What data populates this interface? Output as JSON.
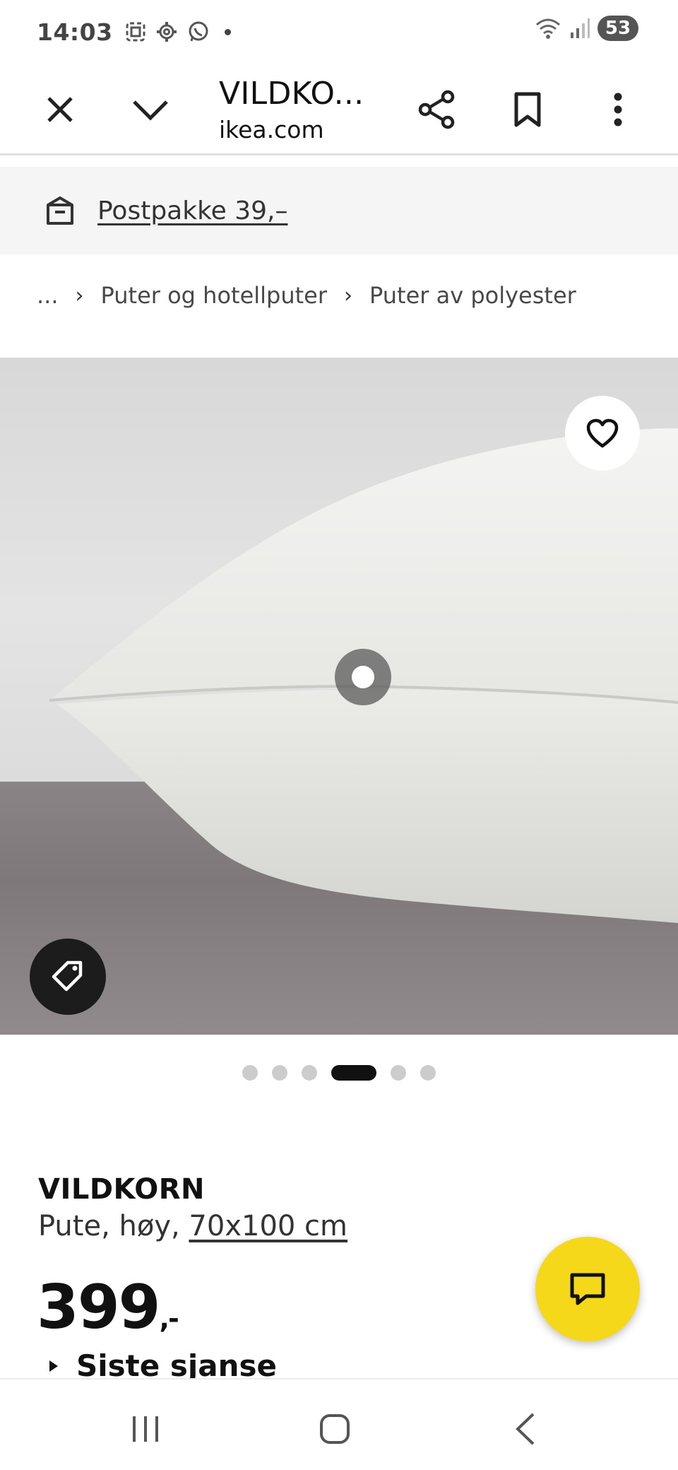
{
  "status_bar": {
    "time": "14:03",
    "battery": "53",
    "icons": [
      "screenshot-icon",
      "settings-icon",
      "whatsapp-icon",
      "wifi-icon",
      "signal-icon"
    ]
  },
  "browser": {
    "page_title": "VILDKO...",
    "domain": "ikea.com",
    "close_icon": "close-icon",
    "collapse_icon": "chevron-down-icon",
    "share_icon": "share-icon",
    "bookmark_icon": "bookmark-icon",
    "menu_icon": "more-vert-icon"
  },
  "delivery": {
    "label": "Postpakke 39,–",
    "icon": "package-icon"
  },
  "breadcrumb": {
    "items": [
      "...",
      "Puter og hotellputer",
      "Puter av polyester"
    ]
  },
  "carousel": {
    "total": 6,
    "active_index": 3
  },
  "product": {
    "name": "VILDKORN",
    "desc_prefix": "Pute, høy, ",
    "size": "70x100 cm",
    "price": "399",
    "price_suffix": ",-",
    "last_chance": "Siste sjanse"
  },
  "colors": {
    "accent_yellow": "#f6d81b",
    "dark": "#111111"
  }
}
